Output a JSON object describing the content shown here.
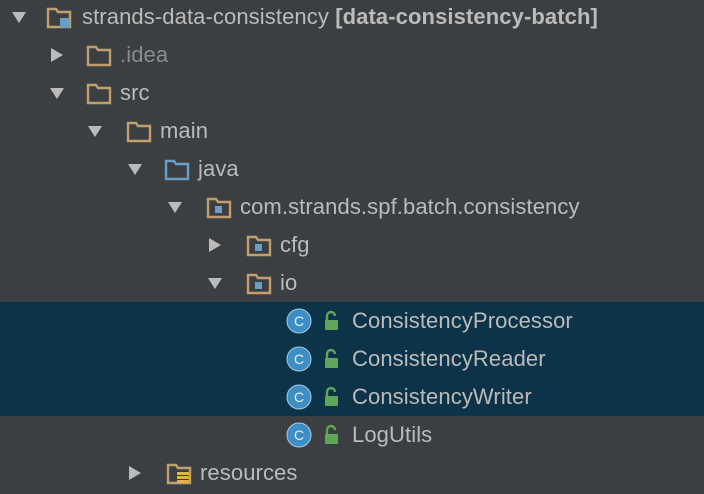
{
  "colors": {
    "background": "#3c3f41",
    "selection": "#0d3349",
    "text": "#bbbbbb",
    "muted_text": "#8c8c8c",
    "folder": "#c29f71",
    "source_folder": "#6a9fc5",
    "class_badge": "#3d8ec4",
    "lock_green": "#5fa55a",
    "resources_bars": "#e2b34c"
  },
  "tree": {
    "rows": [
      {
        "id": "project-root",
        "label": "strands-data-consistency",
        "suffix": "[data-consistency-batch]",
        "icon": "module-folder-icon",
        "expanded": true
      },
      {
        "id": "idea",
        "label": ".idea",
        "icon": "folder-icon",
        "expanded": false,
        "muted": true
      },
      {
        "id": "src",
        "label": "src",
        "icon": "folder-icon",
        "expanded": true
      },
      {
        "id": "main",
        "label": "main",
        "icon": "folder-icon",
        "expanded": true
      },
      {
        "id": "java",
        "label": "java",
        "icon": "source-folder-icon",
        "expanded": true
      },
      {
        "id": "pkg",
        "label": "com.strands.spf.batch.consistency",
        "icon": "package-icon",
        "expanded": true
      },
      {
        "id": "cfg",
        "label": "cfg",
        "icon": "package-icon",
        "expanded": false
      },
      {
        "id": "io",
        "label": "io",
        "icon": "package-icon",
        "expanded": true
      },
      {
        "id": "consistency-processor",
        "label": "ConsistencyProcessor",
        "icon": "class-icon",
        "selected": true
      },
      {
        "id": "consistency-reader",
        "label": "ConsistencyReader",
        "icon": "class-icon",
        "selected": true
      },
      {
        "id": "consistency-writer",
        "label": "ConsistencyWriter",
        "icon": "class-icon",
        "selected": true
      },
      {
        "id": "log-utils",
        "label": "LogUtils",
        "icon": "class-icon",
        "selected": false
      },
      {
        "id": "resources",
        "label": "resources",
        "icon": "resources-folder-icon",
        "expanded": false
      }
    ],
    "class_badge_letter": "C"
  }
}
